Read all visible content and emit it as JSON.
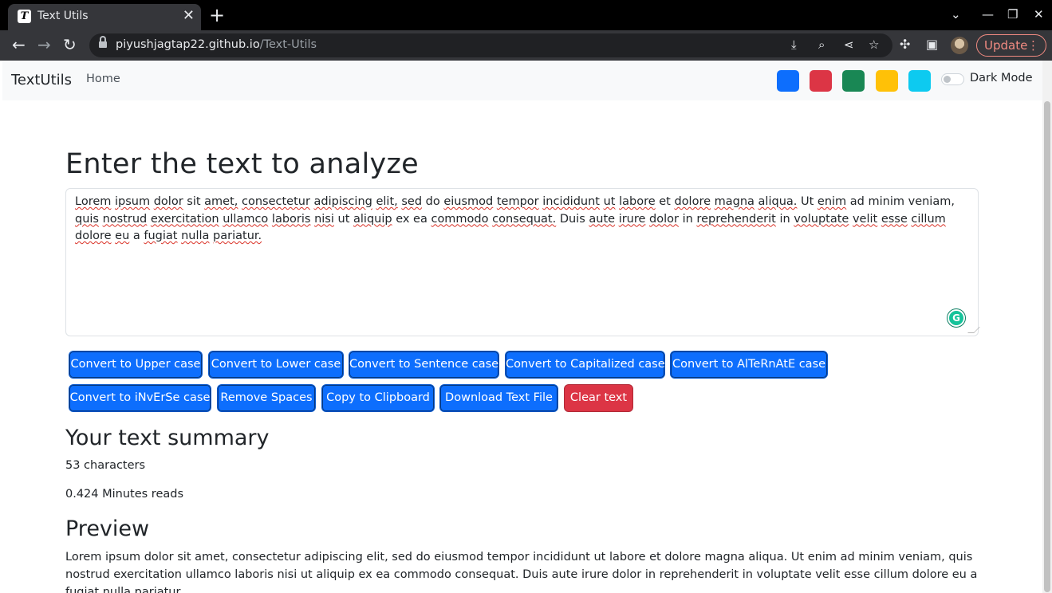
{
  "browser": {
    "tab_title": "Text Utils",
    "tab_favicon": "T",
    "url_host": "piyushjagtap22.github.io",
    "url_path": "/Text-Utils",
    "update_label": "Update"
  },
  "navbar": {
    "brand": "TextUtils",
    "home": "Home",
    "theme_colors": [
      "#0d6efd",
      "#dc3545",
      "#198754",
      "#ffc107",
      "#0dcaf0"
    ],
    "dark_mode_label": "Dark Mode",
    "dark_mode_on": false
  },
  "main": {
    "heading": "Enter the text to analyze",
    "textarea_words": [
      "Lorem",
      "ipsum",
      "dolor",
      "sit",
      "amet,",
      "consectetur",
      "adipiscing",
      "elit,",
      "sed",
      "do",
      "eiusmod",
      "tempor",
      "incididunt",
      "ut",
      "labore",
      "et",
      "dolore",
      "magna",
      "aliqua.",
      "Ut",
      "enim",
      "ad",
      "minim",
      "veniam,",
      "quis",
      "nostrud",
      "exercitation",
      "ullamco",
      "laboris",
      "nisi",
      "ut",
      "aliquip",
      "ex",
      "ea",
      "commodo",
      "consequat.",
      "Duis",
      "aute",
      "irure",
      "dolor",
      "in",
      "reprehenderit",
      "in",
      "voluptate",
      "velit",
      "esse",
      "cillum",
      "dolore",
      "eu",
      "a",
      "fugiat",
      "nulla",
      "pariatur."
    ],
    "buttons": {
      "upper": "Convert to Upper case",
      "lower": "Convert to Lower case",
      "sentence": "Convert to Sentence case",
      "capitalized": "Convert to Capitalized case",
      "alternate": "Convert to AlTeRnAtE case",
      "inverse": "Convert to iNvErSe case",
      "remove_spaces": "Remove Spaces",
      "copy": "Copy to Clipboard",
      "download": "Download Text File",
      "clear": "Clear text"
    }
  },
  "summary": {
    "heading": "Your text summary",
    "characters": "53 characters",
    "read_time": "0.424 Minutes reads"
  },
  "preview": {
    "heading": "Preview",
    "text": "Lorem ipsum dolor sit amet, consectetur adipiscing elit, sed do eiusmod tempor incididunt ut labore et dolore magna aliqua. Ut enim ad minim veniam, quis nostrud exercitation ullamco laboris nisi ut aliquip ex ea commodo consequat. Duis aute irure dolor in reprehenderit in voluptate velit esse cillum dolore eu a fugiat nulla pariatur."
  }
}
